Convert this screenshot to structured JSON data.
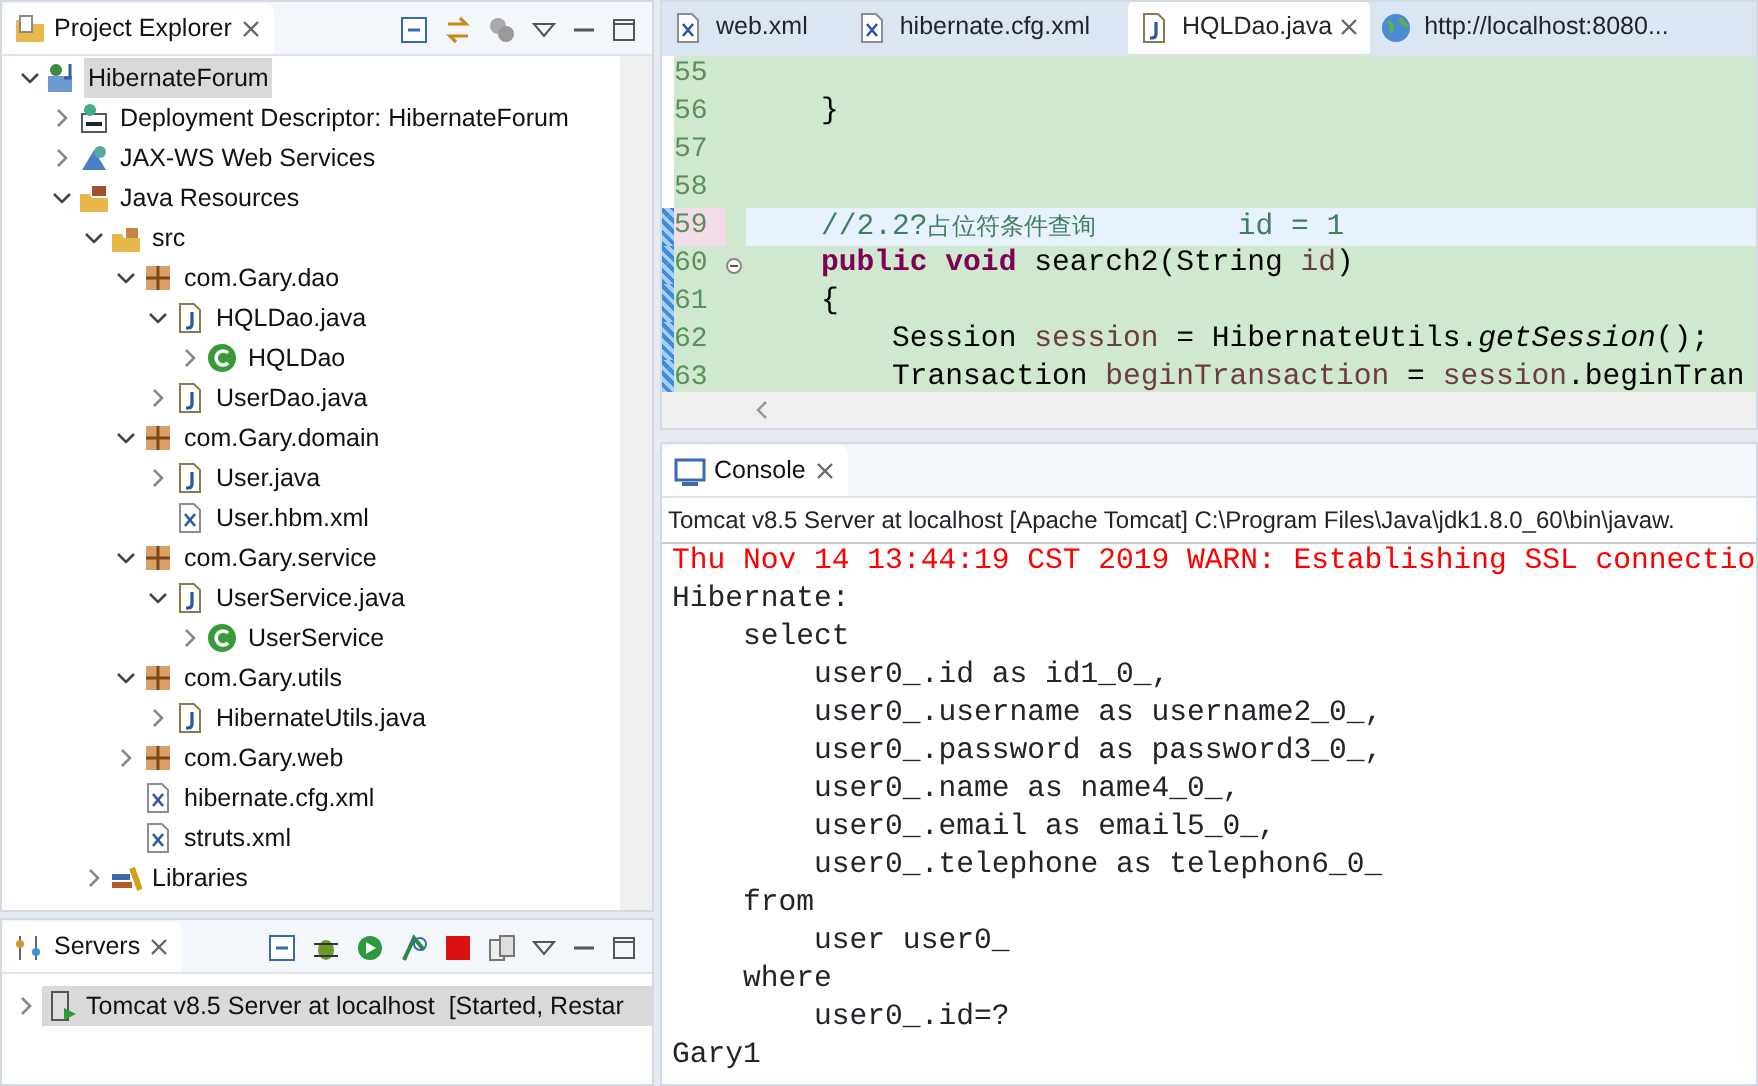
{
  "project_explorer": {
    "title": "Project Explorer",
    "tree": [
      {
        "label": "HibernateForum",
        "kind": "project",
        "expanded": true,
        "selected": true,
        "children": [
          {
            "label": "Deployment Descriptor: HibernateForum",
            "kind": "descriptor",
            "expanded": false,
            "selected": false
          },
          {
            "label": "JAX-WS Web Services",
            "kind": "webservices",
            "expanded": false,
            "selected": false
          },
          {
            "label": "Java Resources",
            "kind": "resources",
            "expanded": true,
            "selected": false,
            "children": [
              {
                "label": "src",
                "kind": "srcfolder",
                "expanded": true,
                "selected": false,
                "children": [
                  {
                    "label": "com.Gary.dao",
                    "kind": "package",
                    "expanded": true,
                    "selected": false,
                    "children": [
                      {
                        "label": "HQLDao.java",
                        "kind": "java",
                        "expanded": true,
                        "selected": false,
                        "children": [
                          {
                            "label": "HQLDao",
                            "kind": "class",
                            "expanded": false,
                            "selected": false
                          }
                        ]
                      },
                      {
                        "label": "UserDao.java",
                        "kind": "java",
                        "expanded": false,
                        "selected": false
                      }
                    ]
                  },
                  {
                    "label": "com.Gary.domain",
                    "kind": "package",
                    "expanded": true,
                    "selected": false,
                    "children": [
                      {
                        "label": "User.java",
                        "kind": "java",
                        "expanded": false,
                        "selected": false
                      },
                      {
                        "label": "User.hbm.xml",
                        "kind": "xml",
                        "selected": false
                      }
                    ]
                  },
                  {
                    "label": "com.Gary.service",
                    "kind": "package",
                    "expanded": true,
                    "selected": false,
                    "children": [
                      {
                        "label": "UserService.java",
                        "kind": "java",
                        "expanded": true,
                        "selected": false,
                        "children": [
                          {
                            "label": "UserService",
                            "kind": "class",
                            "expanded": false,
                            "selected": false
                          }
                        ]
                      }
                    ]
                  },
                  {
                    "label": "com.Gary.utils",
                    "kind": "package",
                    "expanded": true,
                    "selected": false,
                    "children": [
                      {
                        "label": "HibernateUtils.java",
                        "kind": "java",
                        "expanded": false,
                        "selected": false
                      }
                    ]
                  },
                  {
                    "label": "com.Gary.web",
                    "kind": "package",
                    "expanded": false,
                    "selected": false
                  },
                  {
                    "label": "hibernate.cfg.xml",
                    "kind": "xml",
                    "selected": false
                  },
                  {
                    "label": "struts.xml",
                    "kind": "xml",
                    "selected": false
                  }
                ]
              },
              {
                "label": "Libraries",
                "kind": "libraries",
                "expanded": false,
                "selected": false
              }
            ]
          }
        ]
      }
    ]
  },
  "servers": {
    "title": "Servers",
    "rows": [
      {
        "label": "Tomcat v8.5 Server at localhost  [Started, Restar",
        "expanded": false,
        "selected": true
      }
    ]
  },
  "editor": {
    "tabs": [
      {
        "label": "web.xml",
        "kind": "xml",
        "selected": false
      },
      {
        "label": "hibernate.cfg.xml",
        "kind": "xml",
        "selected": false
      },
      {
        "label": "HQLDao.java",
        "kind": "java",
        "selected": true
      },
      {
        "label": "http://localhost:8080...",
        "kind": "globe",
        "selected": false
      }
    ],
    "lines": [
      {
        "number": "55",
        "current": false,
        "changed": false,
        "fold": false
      },
      {
        "number": "56",
        "current": false,
        "changed": false,
        "fold": false,
        "tokens": [
          {
            "kind": "plain",
            "text": "    }"
          }
        ]
      },
      {
        "number": "57",
        "current": false,
        "changed": false,
        "fold": false
      },
      {
        "number": "58",
        "current": false,
        "changed": false,
        "fold": false
      },
      {
        "number": "59",
        "current": true,
        "changed": true,
        "fold": false,
        "tokens": [
          {
            "kind": "comment",
            "text": "    //2.2?"
          },
          {
            "kind": "comment-cjk",
            "text": "占位符条件查询"
          },
          {
            "kind": "comment",
            "text": "        id = 1"
          }
        ]
      },
      {
        "number": "60",
        "current": false,
        "changed": true,
        "fold": true,
        "tokens": [
          {
            "kind": "keyword",
            "text": "    public"
          },
          {
            "kind": "keyword",
            "text": " void"
          },
          {
            "kind": "plain",
            "text": " search2(String "
          },
          {
            "kind": "variable",
            "text": "id"
          },
          {
            "kind": "plain",
            "text": ")"
          }
        ]
      },
      {
        "number": "61",
        "current": false,
        "changed": true,
        "fold": false,
        "tokens": [
          {
            "kind": "plain",
            "text": "    {"
          }
        ]
      },
      {
        "number": "62",
        "current": false,
        "changed": true,
        "fold": false,
        "tokens": [
          {
            "kind": "plain",
            "text": "        Session "
          },
          {
            "kind": "variable",
            "text": "session"
          },
          {
            "kind": "plain",
            "text": " = HibernateUtils."
          },
          {
            "kind": "static",
            "text": "getSession"
          },
          {
            "kind": "plain",
            "text": "();"
          }
        ]
      },
      {
        "number": "63",
        "current": false,
        "changed": true,
        "fold": false,
        "tokens": [
          {
            "kind": "plain",
            "text": "        Transaction "
          },
          {
            "kind": "variable",
            "text": "beginTransaction"
          },
          {
            "kind": "plain",
            "text": " = "
          },
          {
            "kind": "variable",
            "text": "session"
          },
          {
            "kind": "plain",
            "text": ".beginTran"
          }
        ]
      }
    ]
  },
  "console": {
    "title": "Console",
    "header": "Tomcat v8.5 Server at localhost [Apache Tomcat] C:\\Program Files\\Java\\jdk1.8.0_60\\bin\\javaw.",
    "lines": [
      {
        "kind": "error",
        "text": "Thu Nov 14 13:44:19 CST 2019 WARN: Establishing SSL connectio"
      },
      {
        "kind": "out",
        "text": "Hibernate: "
      },
      {
        "kind": "out",
        "text": "    select"
      },
      {
        "kind": "out",
        "text": "        user0_.id as id1_0_,"
      },
      {
        "kind": "out",
        "text": "        user0_.username as username2_0_,"
      },
      {
        "kind": "out",
        "text": "        user0_.password as password3_0_,"
      },
      {
        "kind": "out",
        "text": "        user0_.name as name4_0_,"
      },
      {
        "kind": "out",
        "text": "        user0_.email as email5_0_,"
      },
      {
        "kind": "out",
        "text": "        user0_.telephone as telephon6_0_ "
      },
      {
        "kind": "out",
        "text": "    from"
      },
      {
        "kind": "out",
        "text": "        user user0_ "
      },
      {
        "kind": "out",
        "text": "    where"
      },
      {
        "kind": "out",
        "text": "        user0_.id=?"
      },
      {
        "kind": "out",
        "text": "Gary1"
      }
    ]
  }
}
